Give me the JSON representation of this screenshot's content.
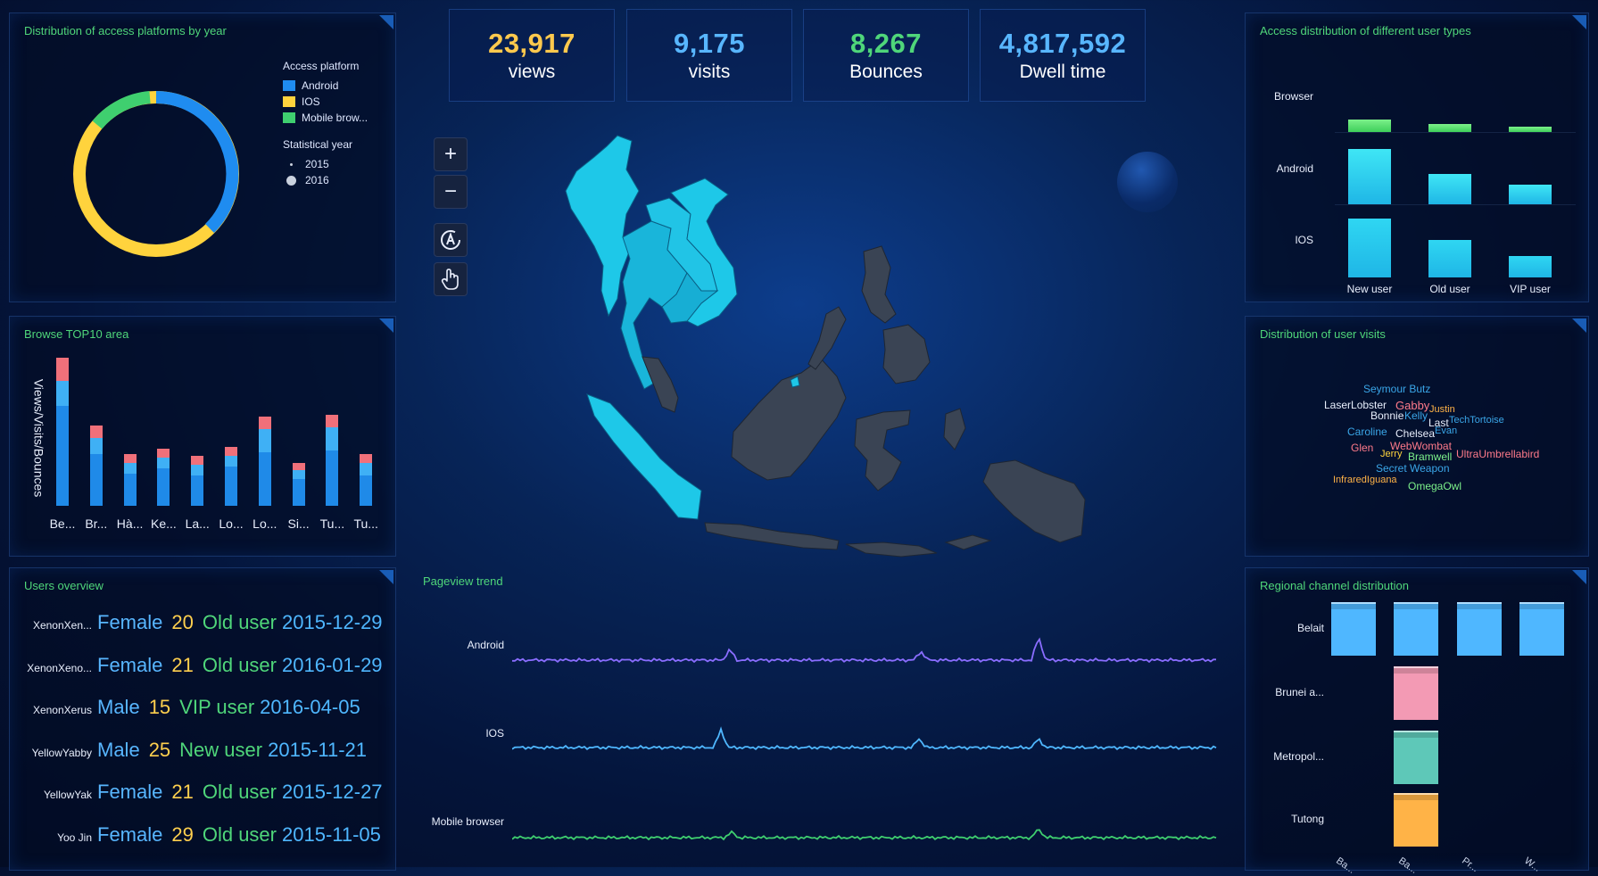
{
  "stats": [
    {
      "value": "23,917",
      "label": "views",
      "color": "#ffc94d"
    },
    {
      "value": "9,175",
      "label": "visits",
      "color": "#58b6ff"
    },
    {
      "value": "8,267",
      "label": "Bounces",
      "color": "#4fd67a"
    },
    {
      "value": "4,817,592",
      "label": "Dwell time",
      "color": "#58b6ff"
    }
  ],
  "donut": {
    "title": "Distribution of access platforms by year",
    "legend_title": "Access platform",
    "legend": [
      {
        "name": "Android",
        "color": "#1f8cf0"
      },
      {
        "name": "IOS",
        "color": "#ffd33d"
      },
      {
        "name": "Mobile brow...",
        "color": "#3fcf6f"
      }
    ],
    "year_title": "Statistical year",
    "years": [
      "2015",
      "2016"
    ]
  },
  "top10": {
    "title": "Browse TOP10 area",
    "ylabel": "Views/Visits/Bounces",
    "categories": [
      "Be...",
      "Br...",
      "Hà...",
      "Ke...",
      "La...",
      "Lo...",
      "Lo...",
      "Si...",
      "Tu...",
      "Tu..."
    ]
  },
  "users": {
    "title": "Users overview",
    "rows": [
      {
        "name": "XenonXen...",
        "gender": "Female",
        "age": "20",
        "type": "Old user",
        "date": "2015-12-29"
      },
      {
        "name": "XenonXeno...",
        "gender": "Female",
        "age": "21",
        "type": "Old user",
        "date": "2016-01-29"
      },
      {
        "name": "XenonXerus",
        "gender": "Male",
        "age": "15",
        "type": "VIP user",
        "date": "2016-04-05"
      },
      {
        "name": "YellowYabby",
        "gender": "Male",
        "age": "25",
        "type": "New user",
        "date": "2015-11-21"
      },
      {
        "name": "YellowYak",
        "gender": "Female",
        "age": "21",
        "type": "Old user",
        "date": "2015-12-27"
      },
      {
        "name": "Yoo Jin",
        "gender": "Female",
        "age": "29",
        "type": "Old user",
        "date": "2015-11-05"
      }
    ]
  },
  "map": {
    "buttons": [
      "zoom-in",
      "zoom-out",
      "reset",
      "pan"
    ],
    "zoom_in_label": "+",
    "zoom_out_label": "−"
  },
  "trend": {
    "title": "Pageview trend",
    "series": [
      "Android",
      "IOS",
      "Mobile browser"
    ]
  },
  "usertypes": {
    "title": "Access distribution of different user types",
    "rows": [
      "Browser",
      "Android",
      "IOS"
    ],
    "cols": [
      "New user",
      "Old user",
      "VIP user"
    ]
  },
  "wordcloud": {
    "title": "Distribution of user visits",
    "words": [
      {
        "text": "Seymour Butz",
        "color": "#3aa6e8"
      },
      {
        "text": "LaserLobster",
        "color": "#e8eefc"
      },
      {
        "text": "Gabby",
        "color": "#ff7a8a"
      },
      {
        "text": "Justin",
        "color": "#ffb347"
      },
      {
        "text": "Bonnie",
        "color": "#e8eefc"
      },
      {
        "text": "Kelly",
        "color": "#3aa6e8"
      },
      {
        "text": "Last",
        "color": "#e8eefc"
      },
      {
        "text": "TechTortoise",
        "color": "#3aa6e8"
      },
      {
        "text": "Caroline",
        "color": "#3aa6e8"
      },
      {
        "text": "Chelsea",
        "color": "#e8eefc"
      },
      {
        "text": "Evan",
        "color": "#3aa6e8"
      },
      {
        "text": "Glen",
        "color": "#ff7a8a"
      },
      {
        "text": "WebWombat",
        "color": "#ff7a8a"
      },
      {
        "text": "Jerry",
        "color": "#ffd33d"
      },
      {
        "text": "Bramwell",
        "color": "#7cf08a"
      },
      {
        "text": "UltraUmbrellabird",
        "color": "#ff7a8a"
      },
      {
        "text": "Secret Weapon",
        "color": "#3aa6e8"
      },
      {
        "text": "InfraredIguana",
        "color": "#ffb347"
      },
      {
        "text": "OmegaOwl",
        "color": "#7cf08a"
      }
    ]
  },
  "regional": {
    "title": "Regional channel distribution",
    "rows": [
      "Belait",
      "Brunei a...",
      "Metropol...",
      "Tutong"
    ],
    "cols": [
      "Ba...",
      "Ba...",
      "Pr...",
      "W..."
    ]
  }
}
